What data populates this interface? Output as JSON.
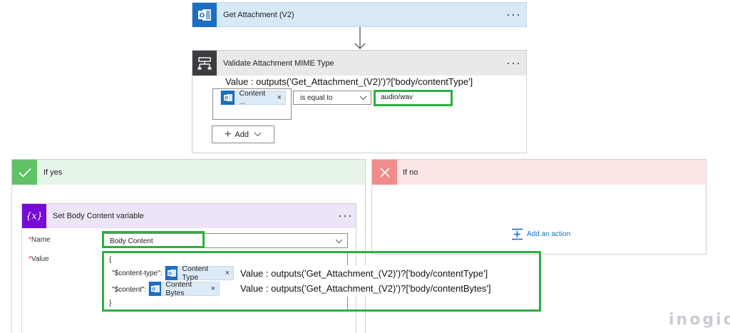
{
  "get_attachment": {
    "title": "Get Attachment (V2)",
    "more": "···"
  },
  "validate": {
    "title": "Validate Attachment MIME Type",
    "more": "···",
    "value_note": "Value : outputs('Get_Attachment_(V2)')?['body/contentType']",
    "token_label": "Content ...",
    "token_close": "×",
    "operator": "is equal to",
    "operand": "audio/wav",
    "add_label": "Add"
  },
  "if_yes": {
    "title": "If yes"
  },
  "if_no": {
    "title": "If no",
    "add_action": "Add an action"
  },
  "set_var": {
    "title": "Set Body Content variable",
    "more": "···",
    "name_label": "Name",
    "name_value": "Body Content",
    "value_label": "Value",
    "required_mark": "*",
    "open_brace": "{",
    "close_brace": "}",
    "key_content_type": "\"$content-type\":",
    "key_content": "\"$content\":",
    "token1_label": "Content Type",
    "token2_label": "Content Bytes",
    "token_close": "×",
    "note_content_type": "Value : outputs('Get_Attachment_(V2)')?['body/contentType']",
    "note_content_bytes": "Value : outputs('Get_Attachment_(V2)')?['body/contentBytes']"
  },
  "watermark": "inogic",
  "colors": {
    "outlook_blue": "#1b6ec2",
    "header_blue": "#d7e8f6",
    "condition_dark": "#3c3c41",
    "header_gray": "#e9e9ea",
    "yes_green": "#60c265",
    "yes_bg": "#e6f4e7",
    "no_red": "#f08c8c",
    "no_bg": "#fde6e6",
    "variable_purple": "#770bd6",
    "variable_bg": "#eee4f7",
    "highlight_green": "#2db040"
  }
}
